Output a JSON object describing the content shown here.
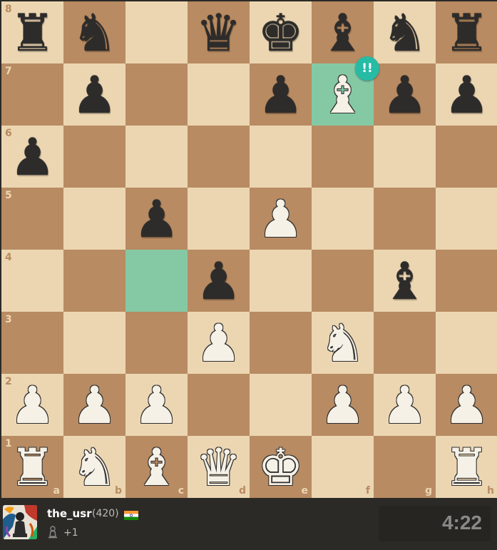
{
  "board": {
    "ranks": [
      "8",
      "7",
      "6",
      "5",
      "4",
      "3",
      "2",
      "1"
    ],
    "files": [
      "a",
      "b",
      "c",
      "d",
      "e",
      "f",
      "g",
      "h"
    ],
    "highlighted": [
      "f7",
      "c4"
    ],
    "pieces": {
      "a8": "bR",
      "b8": "bN",
      "d8": "bQ",
      "e8": "bK",
      "f8": "bB",
      "g8": "bN",
      "h8": "bR",
      "b7": "bP",
      "e7": "bP",
      "f7": "wB",
      "g7": "bP",
      "h7": "bP",
      "a6": "bP",
      "c5": "bP",
      "e5": "wP",
      "d4": "bP",
      "g4": "bB",
      "d3": "wP",
      "f3": "wN",
      "a2": "wP",
      "b2": "wP",
      "c2": "wP",
      "f2": "wP",
      "g2": "wP",
      "h2": "wP",
      "a1": "wR",
      "b1": "wN",
      "c1": "wB",
      "d1": "wQ",
      "e1": "wK",
      "h1": "wR"
    },
    "annotation": {
      "square": "f7",
      "symbol": "!!",
      "color": "#26bba5"
    },
    "colors": {
      "light": "#ecd6b2",
      "dark": "#b88b62",
      "highlight": "#85c9a4"
    }
  },
  "player": {
    "name": "the_usr",
    "rating": "(420)",
    "country_flag": "india-flag-icon",
    "material_advantage": "+1"
  },
  "clock": {
    "time": "4:22"
  }
}
